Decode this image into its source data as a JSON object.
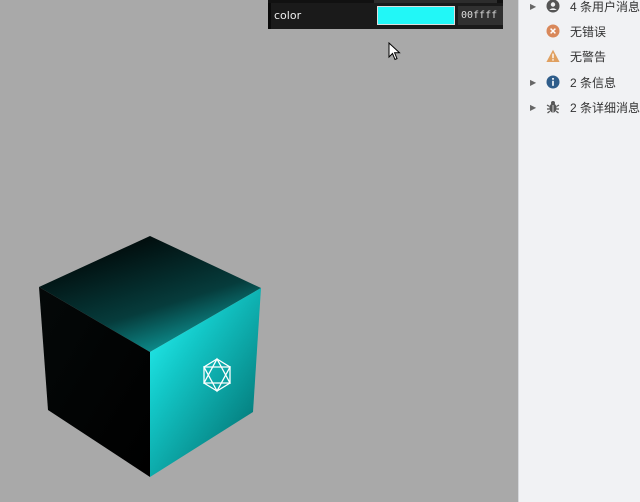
{
  "gui": {
    "property_label": "color",
    "color_hex": "00ffff",
    "color_value": "#22f7f7"
  },
  "console": {
    "items": [
      {
        "label": "4 条用户消息",
        "icon": "user-icon",
        "expandable": true
      },
      {
        "label": "无错误",
        "icon": "error-icon",
        "expandable": false
      },
      {
        "label": "无警告",
        "icon": "warning-icon",
        "expandable": false
      },
      {
        "label": "2 条信息",
        "icon": "info-icon",
        "expandable": true
      },
      {
        "label": "2 条详细消息",
        "icon": "bug-icon",
        "expandable": true
      }
    ]
  },
  "scene": {
    "background": "#a9a9a9",
    "cube_color": "#00ffff",
    "face_icon": "hexagram-icon"
  }
}
